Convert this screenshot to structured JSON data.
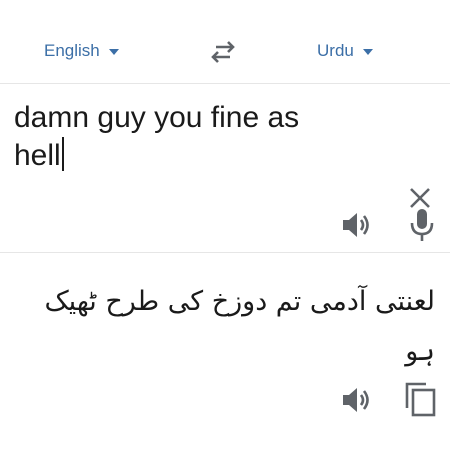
{
  "languages": {
    "source": "English",
    "target": "Urdu"
  },
  "input": {
    "text": "damn guy you fine as hell"
  },
  "output": {
    "text": "لعنتی آدمی تم دوزخ کی طرح ٹھیک ہو"
  },
  "icons": {
    "source_dropdown": "chevron-down-icon",
    "target_dropdown": "chevron-down-icon",
    "swap": "swap-icon",
    "clear": "close-icon",
    "speaker": "speaker-icon",
    "mic": "microphone-icon",
    "copy": "copy-icon"
  },
  "colors": {
    "accent": "#3c6fa7",
    "icon": "#5f6368",
    "text": "#1a1a1a",
    "divider": "#e6e6e6"
  }
}
